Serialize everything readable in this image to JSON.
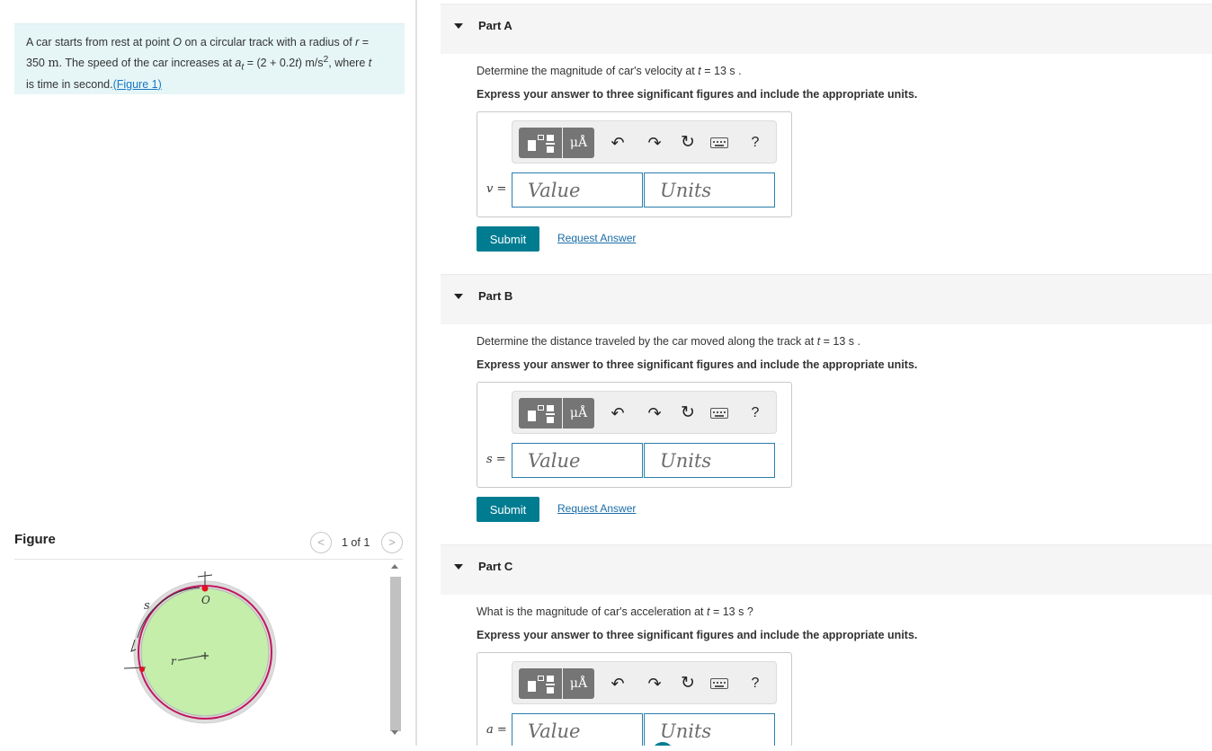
{
  "problem": {
    "t1": "A car starts from rest at point ",
    "var_O": "O",
    "t2": " on a circular track with a radius of ",
    "var_r": "r",
    "eq": " = ",
    "radius_value": "350",
    "radius_unit": "m",
    "t3": ". The speed of the car increases at ",
    "var_a": "a",
    "sub_t": "t",
    "t4": " = (2 + 0.2",
    "var_t1": "t",
    "t5": ") m/s",
    "sup2": "2",
    "t6": ", where ",
    "var_t2": "t",
    "t7": " is time in second.",
    "figure_link": "(Figure 1)"
  },
  "figure": {
    "title": "Figure",
    "counter": "1 of 1",
    "prev_glyph": "<",
    "next_glyph": ">",
    "labels": {
      "s": "s",
      "O": "O",
      "r": "r"
    }
  },
  "toolbar": {
    "symbols_label": "μÅ",
    "undo": "↶",
    "redo": "↷",
    "reset": "↻",
    "help": "?"
  },
  "parts": [
    {
      "title": "Part A",
      "q_before": "Determine the magnitude of car's velocity at ",
      "q_var": "t",
      "q_after": " = 13 s .",
      "instruction": "Express your answer to three significant figures and include the appropriate units.",
      "var": "v",
      "eq": " =",
      "value_placeholder": "Value",
      "units_placeholder": "Units",
      "submit": "Submit",
      "request": "Request Answer"
    },
    {
      "title": "Part B",
      "q_before": "Determine the distance traveled by the car moved along the track at ",
      "q_var": "t",
      "q_after": " = 13 s .",
      "instruction": "Express your answer to three significant figures and include the appropriate units.",
      "var": "s",
      "eq": " =",
      "value_placeholder": "Value",
      "units_placeholder": "Units",
      "submit": "Submit",
      "request": "Request Answer"
    },
    {
      "title": "Part C",
      "q_before": "What is the magnitude of car's acceleration at ",
      "q_var": "t",
      "q_after": " = 13 s ?",
      "instruction": "Express your answer to three significant figures and include the appropriate units.",
      "var": "a",
      "eq": " =",
      "value_placeholder": "Value",
      "units_placeholder": "Units"
    }
  ],
  "colors": {
    "problem_bg": "#e6f6f7",
    "accent": "#007c91",
    "input_border": "#2a7fad",
    "circle_fill": "#c4eeaa",
    "track": "#c0185c"
  }
}
